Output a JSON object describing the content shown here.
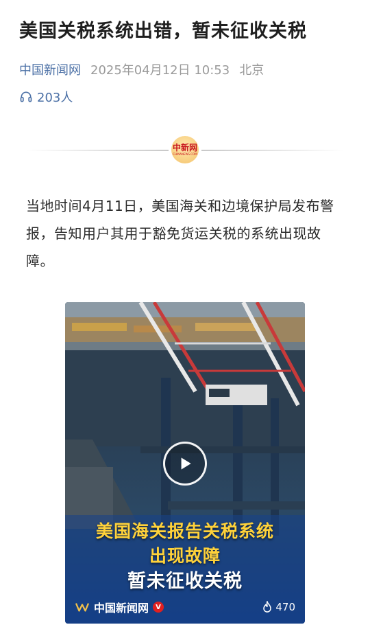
{
  "article": {
    "title": "美国关税系统出错，暂未征收关税",
    "source": "中国新闻网",
    "date": "2025年04月12日 10:53",
    "location": "北京",
    "listen_count": "203人",
    "body": "当地时间4月11日，美国海关和边境保护局发布警报，告知用户其用于豁免货运关税的系统出现故障。"
  },
  "logo": {
    "text": "中新网",
    "subtext": "CHINANEWS.COM"
  },
  "video": {
    "caption_line1": "美国海关报告关税系统",
    "caption_line2": "出现故障",
    "caption_line3": "暂未征收关税",
    "source_label": "中国新闻网",
    "verified_badge": "V",
    "heat_count": "470"
  },
  "colors": {
    "link_blue": "#4a6fa5",
    "caption_yellow": "#ffd23a",
    "badge_red": "#e02020"
  }
}
